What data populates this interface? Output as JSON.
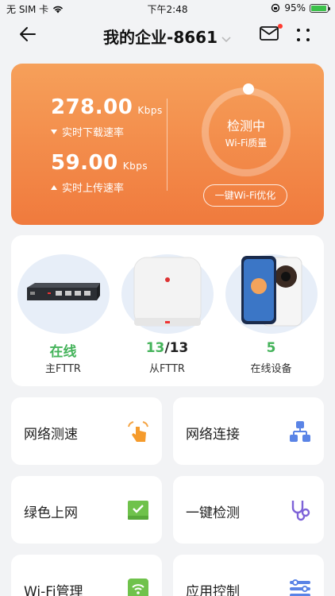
{
  "status_bar": {
    "carrier": "无 SIM 卡",
    "time": "下午2:48",
    "battery": "95%",
    "battery_level": 0.95
  },
  "header": {
    "title": "我的企业-8661"
  },
  "speed": {
    "download_value": "278.00",
    "download_unit": "Kbps",
    "download_label": "实时下载速率",
    "upload_value": "59.00",
    "upload_unit": "Kbps",
    "upload_label": "实时上传速率",
    "status_title": "检测中",
    "status_sub": "Wi-Fi质量",
    "optimize_label": "一键Wi-Fi优化"
  },
  "devices": {
    "main": {
      "status": "在线",
      "label": "主FTTR"
    },
    "sub": {
      "count": "13",
      "total": "/13",
      "label": "从FTTR"
    },
    "online": {
      "count": "5",
      "label": "在线设备"
    }
  },
  "tiles": [
    {
      "label": "网络测速",
      "icon": "hand-tap-icon"
    },
    {
      "label": "网络连接",
      "icon": "network-topology-icon"
    },
    {
      "label": "绿色上网",
      "icon": "green-shield-icon"
    },
    {
      "label": "一键检测",
      "icon": "stethoscope-icon"
    },
    {
      "label": "Wi-Fi管理",
      "icon": "wifi-manage-icon"
    },
    {
      "label": "应用控制",
      "icon": "app-control-icon"
    }
  ],
  "colors": {
    "accent_orange": "#f07a3d",
    "online_green": "#44b35a",
    "blue_icon": "#5a84e6"
  }
}
